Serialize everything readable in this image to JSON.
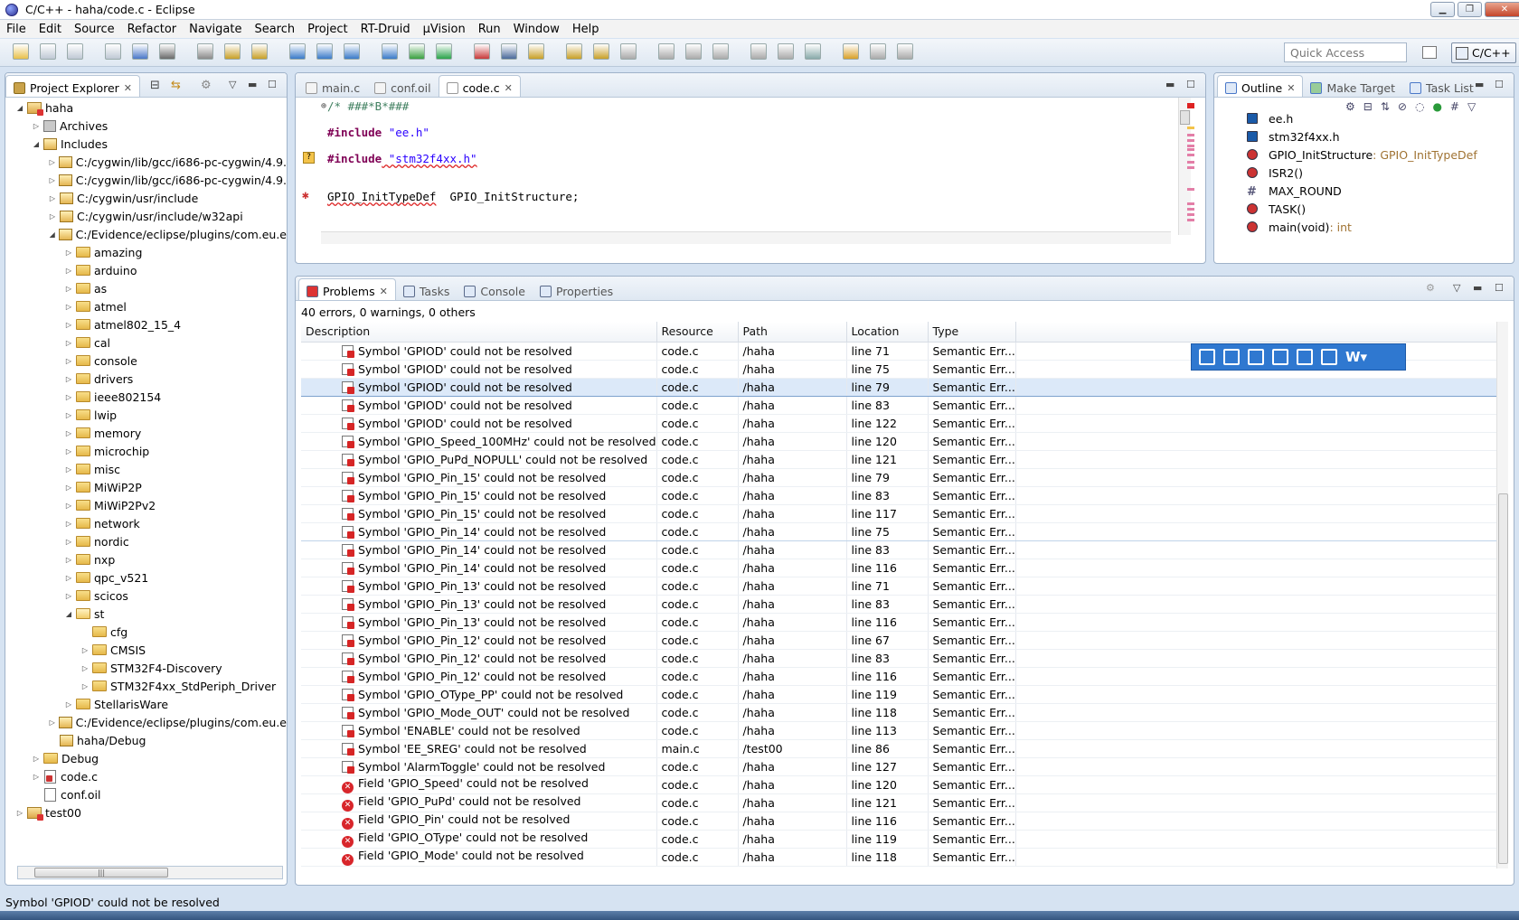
{
  "window": {
    "title": "C/C++ - haha/code.c - Eclipse"
  },
  "menu": [
    "File",
    "Edit",
    "Source",
    "Refactor",
    "Navigate",
    "Search",
    "Project",
    "RT-Druid",
    "µVision",
    "Run",
    "Window",
    "Help"
  ],
  "toolbar": {
    "quick_access": "Quick Access",
    "perspective": "C/C++"
  },
  "explorer": {
    "tab": "Project Explorer",
    "items": [
      {
        "label": "haha",
        "depth": 0,
        "tw": "open",
        "icon": "project"
      },
      {
        "label": "Archives",
        "depth": 1,
        "tw": "closed",
        "icon": "archive"
      },
      {
        "label": "Includes",
        "depth": 1,
        "tw": "open",
        "icon": "includes"
      },
      {
        "label": "C:/cygwin/lib/gcc/i686-pc-cygwin/4.9.",
        "depth": 2,
        "tw": "closed",
        "icon": "incfolder"
      },
      {
        "label": "C:/cygwin/lib/gcc/i686-pc-cygwin/4.9.",
        "depth": 2,
        "tw": "closed",
        "icon": "incfolder"
      },
      {
        "label": "C:/cygwin/usr/include",
        "depth": 2,
        "tw": "closed",
        "icon": "incfolder"
      },
      {
        "label": "C:/cygwin/usr/include/w32api",
        "depth": 2,
        "tw": "closed",
        "icon": "incfolder"
      },
      {
        "label": "C:/Evidence/eclipse/plugins/com.eu.e",
        "depth": 2,
        "tw": "open",
        "icon": "incfolder"
      },
      {
        "label": "amazing",
        "depth": 3,
        "tw": "closed",
        "icon": "folder"
      },
      {
        "label": "arduino",
        "depth": 3,
        "tw": "closed",
        "icon": "folder"
      },
      {
        "label": "as",
        "depth": 3,
        "tw": "closed",
        "icon": "folder"
      },
      {
        "label": "atmel",
        "depth": 3,
        "tw": "closed",
        "icon": "folder"
      },
      {
        "label": "atmel802_15_4",
        "depth": 3,
        "tw": "closed",
        "icon": "folder"
      },
      {
        "label": "cal",
        "depth": 3,
        "tw": "closed",
        "icon": "folder"
      },
      {
        "label": "console",
        "depth": 3,
        "tw": "closed",
        "icon": "folder"
      },
      {
        "label": "drivers",
        "depth": 3,
        "tw": "closed",
        "icon": "folder"
      },
      {
        "label": "ieee802154",
        "depth": 3,
        "tw": "closed",
        "icon": "folder"
      },
      {
        "label": "lwip",
        "depth": 3,
        "tw": "closed",
        "icon": "folder"
      },
      {
        "label": "memory",
        "depth": 3,
        "tw": "closed",
        "icon": "folder"
      },
      {
        "label": "microchip",
        "depth": 3,
        "tw": "closed",
        "icon": "folder"
      },
      {
        "label": "misc",
        "depth": 3,
        "tw": "closed",
        "icon": "folder"
      },
      {
        "label": "MiWiP2P",
        "depth": 3,
        "tw": "closed",
        "icon": "folder"
      },
      {
        "label": "MiWiP2Pv2",
        "depth": 3,
        "tw": "closed",
        "icon": "folder"
      },
      {
        "label": "network",
        "depth": 3,
        "tw": "closed",
        "icon": "folder"
      },
      {
        "label": "nordic",
        "depth": 3,
        "tw": "closed",
        "icon": "folder"
      },
      {
        "label": "nxp",
        "depth": 3,
        "tw": "closed",
        "icon": "folder"
      },
      {
        "label": "qpc_v521",
        "depth": 3,
        "tw": "closed",
        "icon": "folder"
      },
      {
        "label": "scicos",
        "depth": 3,
        "tw": "closed",
        "icon": "folder"
      },
      {
        "label": "st",
        "depth": 3,
        "tw": "open",
        "icon": "folder"
      },
      {
        "label": "cfg",
        "depth": 4,
        "tw": "none",
        "icon": "folder"
      },
      {
        "label": "CMSIS",
        "depth": 4,
        "tw": "closed",
        "icon": "folder"
      },
      {
        "label": "STM32F4-Discovery",
        "depth": 4,
        "tw": "closed",
        "icon": "folder"
      },
      {
        "label": "STM32F4xx_StdPeriph_Driver",
        "depth": 4,
        "tw": "closed",
        "icon": "folder"
      },
      {
        "label": "StellarisWare",
        "depth": 3,
        "tw": "closed",
        "icon": "folder"
      },
      {
        "label": "C:/Evidence/eclipse/plugins/com.eu.e",
        "depth": 2,
        "tw": "closed",
        "icon": "incfolder"
      },
      {
        "label": "haha/Debug",
        "depth": 2,
        "tw": "none",
        "icon": "incfolder"
      },
      {
        "label": "Debug",
        "depth": 1,
        "tw": "closed",
        "icon": "folder"
      },
      {
        "label": "code.c",
        "depth": 1,
        "tw": "closed",
        "icon": "cfile"
      },
      {
        "label": "conf.oil",
        "depth": 1,
        "tw": "none",
        "icon": "file"
      },
      {
        "label": "test00",
        "depth": 0,
        "tw": "closed",
        "icon": "project"
      }
    ]
  },
  "editor": {
    "tabs": [
      {
        "label": "main.c",
        "active": false
      },
      {
        "label": "conf.oil",
        "active": false
      },
      {
        "label": "code.c",
        "active": true
      }
    ],
    "lines": {
      "l1": "/* ###*B*###",
      "l2a": "#include",
      "l2b": " \"ee.h\"",
      "l3a": "#include",
      "l3b": " \"stm32f4xx.h\"",
      "l4a": "GPIO_InitTypeDef",
      "l4b": "  GPIO_InitStructure;",
      "l5": "/*"
    }
  },
  "bottom": {
    "tabs": [
      "Problems",
      "Tasks",
      "Console",
      "Properties"
    ],
    "summary": "40 errors, 0 warnings, 0 others",
    "columns": [
      "Description",
      "Resource",
      "Path",
      "Location",
      "Type"
    ],
    "rows": [
      {
        "d": "Symbol 'GPIOD' could not be resolved",
        "r": "code.c",
        "p": "/haha",
        "l": "line 71",
        "t": "Semantic Err...",
        "k": "s"
      },
      {
        "d": "Symbol 'GPIOD' could not be resolved",
        "r": "code.c",
        "p": "/haha",
        "l": "line 75",
        "t": "Semantic Err...",
        "k": "s"
      },
      {
        "d": "Symbol 'GPIOD' could not be resolved",
        "r": "code.c",
        "p": "/haha",
        "l": "line 79",
        "t": "Semantic Err...",
        "k": "s"
      },
      {
        "d": "Symbol 'GPIOD' could not be resolved",
        "r": "code.c",
        "p": "/haha",
        "l": "line 83",
        "t": "Semantic Err...",
        "k": "s"
      },
      {
        "d": "Symbol 'GPIOD' could not be resolved",
        "r": "code.c",
        "p": "/haha",
        "l": "line 122",
        "t": "Semantic Err...",
        "k": "s"
      },
      {
        "d": "Symbol 'GPIO_Speed_100MHz' could not be resolved",
        "r": "code.c",
        "p": "/haha",
        "l": "line 120",
        "t": "Semantic Err...",
        "k": "s"
      },
      {
        "d": "Symbol 'GPIO_PuPd_NOPULL' could not be resolved",
        "r": "code.c",
        "p": "/haha",
        "l": "line 121",
        "t": "Semantic Err...",
        "k": "s"
      },
      {
        "d": "Symbol 'GPIO_Pin_15' could not be resolved",
        "r": "code.c",
        "p": "/haha",
        "l": "line 79",
        "t": "Semantic Err...",
        "k": "s"
      },
      {
        "d": "Symbol 'GPIO_Pin_15' could not be resolved",
        "r": "code.c",
        "p": "/haha",
        "l": "line 83",
        "t": "Semantic Err...",
        "k": "s"
      },
      {
        "d": "Symbol 'GPIO_Pin_15' could not be resolved",
        "r": "code.c",
        "p": "/haha",
        "l": "line 117",
        "t": "Semantic Err...",
        "k": "s"
      },
      {
        "d": "Symbol 'GPIO_Pin_14' could not be resolved",
        "r": "code.c",
        "p": "/haha",
        "l": "line 75",
        "t": "Semantic Err...",
        "k": "s"
      },
      {
        "d": "Symbol 'GPIO_Pin_14' could not be resolved",
        "r": "code.c",
        "p": "/haha",
        "l": "line 83",
        "t": "Semantic Err...",
        "k": "s"
      },
      {
        "d": "Symbol 'GPIO_Pin_14' could not be resolved",
        "r": "code.c",
        "p": "/haha",
        "l": "line 116",
        "t": "Semantic Err...",
        "k": "s"
      },
      {
        "d": "Symbol 'GPIO_Pin_13' could not be resolved",
        "r": "code.c",
        "p": "/haha",
        "l": "line 71",
        "t": "Semantic Err...",
        "k": "s"
      },
      {
        "d": "Symbol 'GPIO_Pin_13' could not be resolved",
        "r": "code.c",
        "p": "/haha",
        "l": "line 83",
        "t": "Semantic Err...",
        "k": "s"
      },
      {
        "d": "Symbol 'GPIO_Pin_13' could not be resolved",
        "r": "code.c",
        "p": "/haha",
        "l": "line 116",
        "t": "Semantic Err...",
        "k": "s"
      },
      {
        "d": "Symbol 'GPIO_Pin_12' could not be resolved",
        "r": "code.c",
        "p": "/haha",
        "l": "line 67",
        "t": "Semantic Err...",
        "k": "s"
      },
      {
        "d": "Symbol 'GPIO_Pin_12' could not be resolved",
        "r": "code.c",
        "p": "/haha",
        "l": "line 83",
        "t": "Semantic Err...",
        "k": "s"
      },
      {
        "d": "Symbol 'GPIO_Pin_12' could not be resolved",
        "r": "code.c",
        "p": "/haha",
        "l": "line 116",
        "t": "Semantic Err...",
        "k": "s"
      },
      {
        "d": "Symbol 'GPIO_OType_PP' could not be resolved",
        "r": "code.c",
        "p": "/haha",
        "l": "line 119",
        "t": "Semantic Err...",
        "k": "s"
      },
      {
        "d": "Symbol 'GPIO_Mode_OUT' could not be resolved",
        "r": "code.c",
        "p": "/haha",
        "l": "line 118",
        "t": "Semantic Err...",
        "k": "s"
      },
      {
        "d": "Symbol 'ENABLE' could not be resolved",
        "r": "code.c",
        "p": "/haha",
        "l": "line 113",
        "t": "Semantic Err...",
        "k": "s"
      },
      {
        "d": "Symbol 'EE_SREG' could not be resolved",
        "r": "main.c",
        "p": "/test00",
        "l": "line 86",
        "t": "Semantic Err...",
        "k": "s"
      },
      {
        "d": "Symbol 'AlarmToggle' could not be resolved",
        "r": "code.c",
        "p": "/haha",
        "l": "line 127",
        "t": "Semantic Err...",
        "k": "s"
      },
      {
        "d": "Field 'GPIO_Speed' could not be resolved",
        "r": "code.c",
        "p": "/haha",
        "l": "line 120",
        "t": "Semantic Err...",
        "k": "f"
      },
      {
        "d": "Field 'GPIO_PuPd' could not be resolved",
        "r": "code.c",
        "p": "/haha",
        "l": "line 121",
        "t": "Semantic Err...",
        "k": "f"
      },
      {
        "d": "Field 'GPIO_Pin' could not be resolved",
        "r": "code.c",
        "p": "/haha",
        "l": "line 116",
        "t": "Semantic Err...",
        "k": "f"
      },
      {
        "d": "Field 'GPIO_OType' could not be resolved",
        "r": "code.c",
        "p": "/haha",
        "l": "line 119",
        "t": "Semantic Err...",
        "k": "f"
      },
      {
        "d": "Field 'GPIO_Mode' could not be resolved",
        "r": "code.c",
        "p": "/haha",
        "l": "line 118",
        "t": "Semantic Err...",
        "k": "f"
      }
    ]
  },
  "outline": {
    "tabs": [
      "Outline",
      "Make Target",
      "Task List"
    ],
    "items": [
      {
        "name": "ee.h",
        "type": ""
      },
      {
        "name": "stm32f4xx.h",
        "type": ""
      },
      {
        "name": "GPIO_InitStructure",
        "type": " : GPIO_InitTypeDef"
      },
      {
        "name": "ISR2()",
        "type": ""
      },
      {
        "name": "MAX_ROUND",
        "type": ""
      },
      {
        "name": "TASK()",
        "type": ""
      },
      {
        "name": "main(void)",
        "type": " : int"
      }
    ]
  },
  "status": "Symbol 'GPIOD' could not be resolved",
  "colors": {
    "accent": "#2f78d0",
    "error": "#d8262b",
    "selection": "#dce9f9"
  }
}
